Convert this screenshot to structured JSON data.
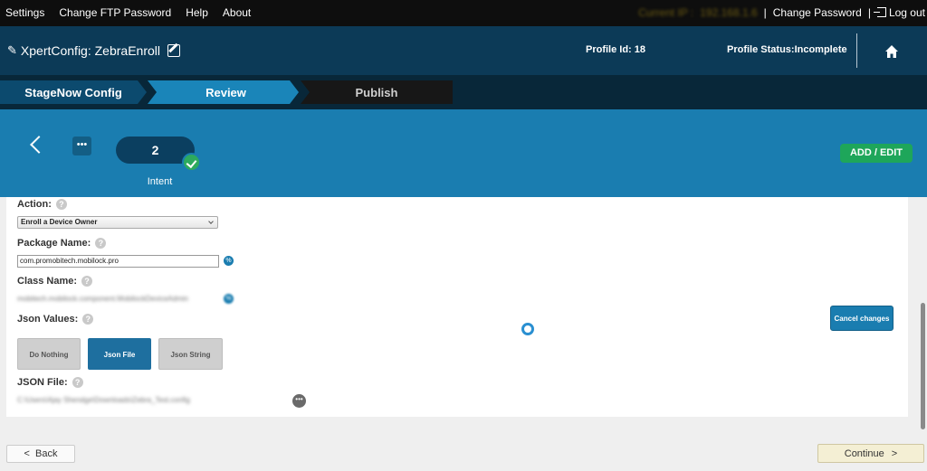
{
  "topbar": {
    "menu": [
      "Settings",
      "Change FTP Password",
      "Help",
      "About"
    ],
    "ip_label": "Current IP :",
    "ip_value": "192.168.1.6",
    "change_password": "Change Password",
    "logout": "Log out"
  },
  "header": {
    "app_title": "XpertConfig: ZebraEnroll",
    "profile_id": "Profile Id: 18",
    "profile_status": "Profile Status:Incomplete"
  },
  "steps": [
    "StageNow Config",
    "Review",
    "Publish"
  ],
  "intent": {
    "number": "2",
    "label": "Intent",
    "add_edit": "ADD / EDIT"
  },
  "form": {
    "action_label": "Action:",
    "action_value": "Enroll a Device Owner",
    "package_label": "Package Name:",
    "package_value": "com.promobitech.mobilock.pro",
    "class_label": "Class Name:",
    "class_value": "mobitech.mobilock.component.MobilockDeviceAdmin",
    "json_values_label": "Json Values:",
    "json_options": [
      "Do Nothing",
      "Json File",
      "Json String"
    ],
    "json_selected": "Json File",
    "json_file_label": "JSON File:",
    "json_file_value": "C:\\Users\\Ajay Shendge\\Downloads\\Zebra_Test.config",
    "cancel_changes": "Cancel changes"
  },
  "footer": {
    "back": "Back",
    "continue": "Continue"
  },
  "colors": {
    "header": "#0c3a57",
    "accent": "#1a7db0",
    "success": "#1ea65a"
  }
}
